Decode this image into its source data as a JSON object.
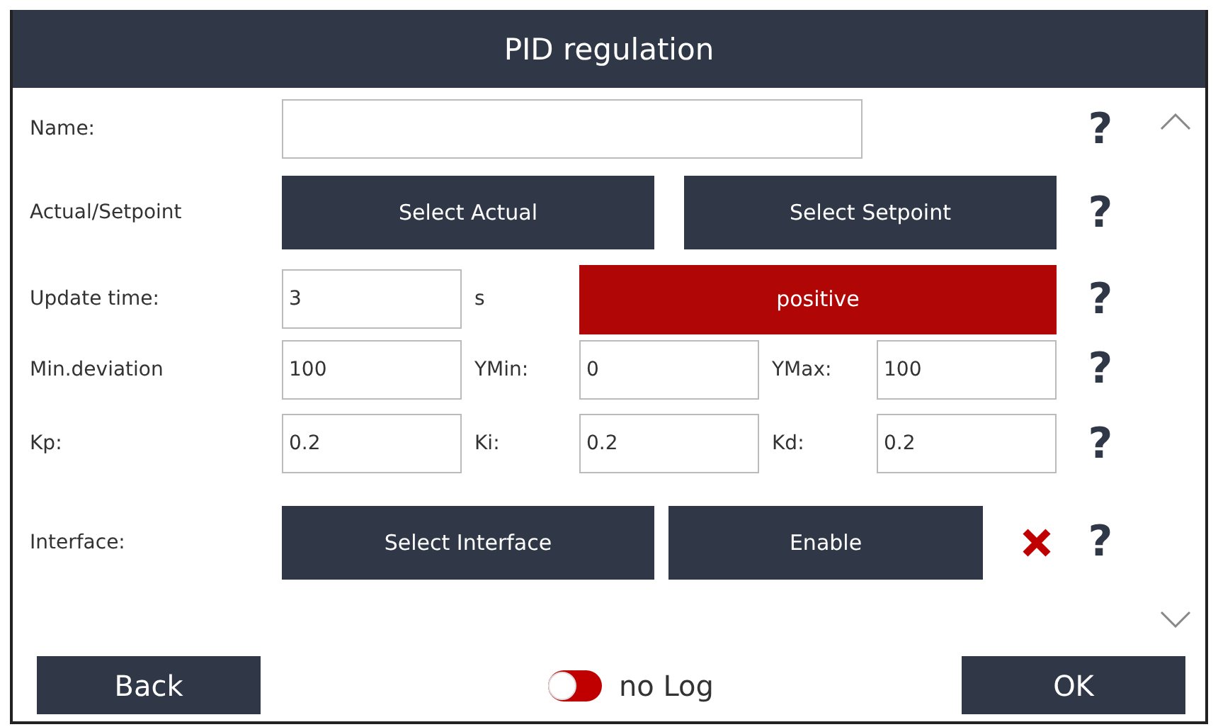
{
  "window": {
    "title": "PID regulation"
  },
  "rows": [
    {
      "label": "Name:",
      "help": "?",
      "items": [
        {
          "kind": "field"
        }
      ]
    },
    {
      "label": "Actual/Setpoint",
      "help": "?",
      "items": [
        {
          "kind": "button",
          "label": "Select Actual"
        },
        {
          "kind": "button",
          "label": "Select Setpoint"
        }
      ]
    },
    {
      "label": "Update time:",
      "help": "?",
      "items": [
        {
          "kind": "field",
          "value": "3"
        },
        {
          "kind": "unit",
          "text": "s"
        },
        {
          "kind": "direction",
          "label": "positive",
          "active": true
        }
      ]
    },
    {
      "label": "Min.deviation",
      "help": "?",
      "items": [
        {
          "kind": "field",
          "value": "100"
        },
        {
          "kind": "unit",
          "text": "YMin:"
        },
        {
          "kind": "field",
          "value": "0"
        },
        {
          "kind": "unit",
          "text": "YMax:"
        },
        {
          "kind": "field",
          "value": "100"
        }
      ]
    },
    {
      "label": "Kp:",
      "help": "?",
      "items": [
        {
          "kind": "field",
          "value": "0.2"
        },
        {
          "kind": "unit",
          "text": "Ki:"
        },
        {
          "kind": "field",
          "value": "0.2"
        },
        {
          "kind": "unit",
          "text": "Kd:"
        },
        {
          "kind": "field",
          "value": "0.2"
        }
      ]
    },
    {
      "label": "Interface:",
      "help": "?",
      "items": [
        {
          "kind": "button",
          "label": "Select Interface"
        },
        {
          "kind": "button",
          "label": "Enable"
        },
        {
          "kind": "status",
          "enabled": false
        }
      ]
    }
  ],
  "footer": {
    "back": "Back",
    "log": {
      "label": "no Log",
      "on": false
    },
    "ok": "OK"
  }
}
